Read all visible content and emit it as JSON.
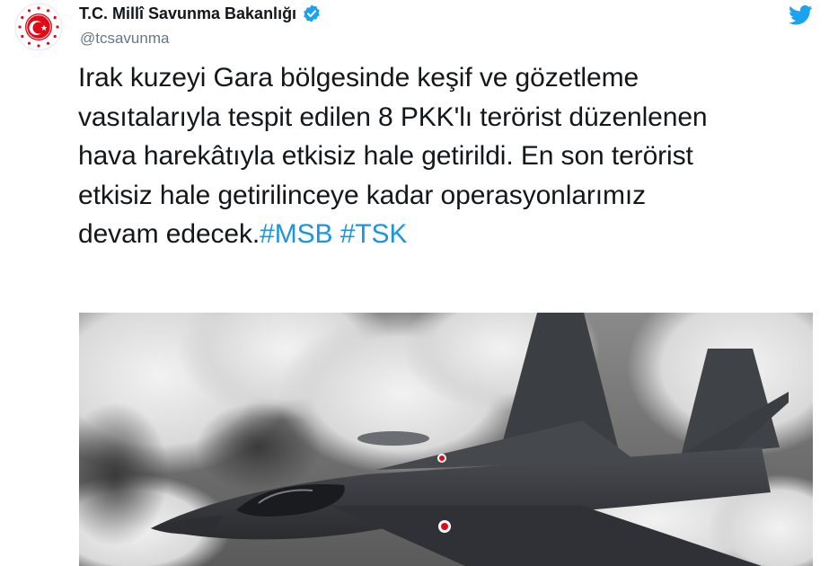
{
  "author": {
    "display_name": "T.C. Millî Savunma Bakanlığı",
    "handle": "@tcsavunma",
    "verified": true,
    "avatar_icon": "crescent-star-emblem-icon"
  },
  "tweet": {
    "lines": [
      "Irak kuzeyi Gara bölgesinde keşif ve gözetleme",
      "vasıtalarıyla tespit edilen 8 PKK'lı terörist düzenlenen",
      "hava harekâtıyla etkisiz hale getirildi. En son terörist",
      "etkisiz hale getirilinceye kadar operasyonlarımız",
      "devam edecek."
    ],
    "hashtags": [
      "#MSB",
      "#TSK"
    ]
  },
  "icons": {
    "brand": "twitter-bird-icon",
    "verified": "verified-badge-icon"
  },
  "colors": {
    "accent": "#1da1f2",
    "hashtag": "#1b95e0",
    "text": "#14171a",
    "secondary": "#657786",
    "emblem_red": "#e30a17"
  }
}
